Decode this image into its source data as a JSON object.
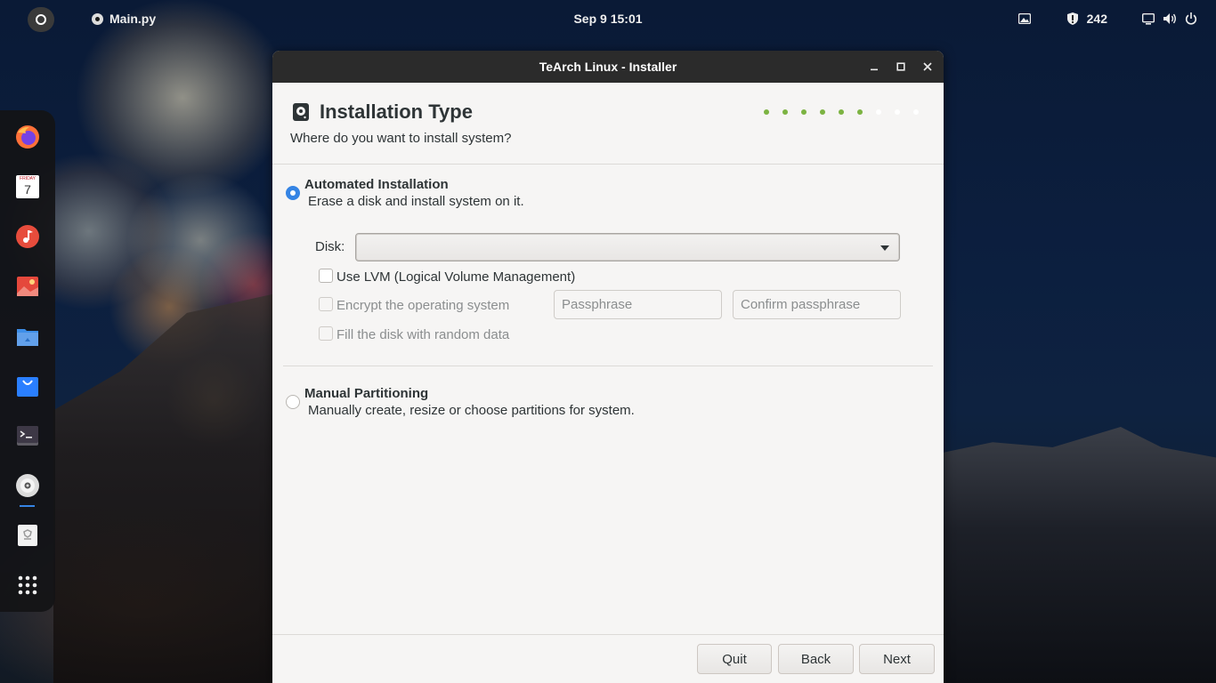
{
  "topbar": {
    "activities_icon": "activities-icon",
    "app_menu_label": "Main.py",
    "clock": "Sep 9  15:01",
    "screenshot_icon": "image-icon",
    "shield_count": "242",
    "tray_icons": [
      "screen-icon",
      "volume-icon",
      "power-icon"
    ]
  },
  "dock": {
    "items": [
      "firefox-icon",
      "calendar-icon",
      "music-icon",
      "image-viewer-icon",
      "files-icon",
      "software-store-icon",
      "terminal-icon",
      "disc-installer-icon",
      "trash-icon",
      "app-grid-icon"
    ],
    "calendar_day_name": "FRIDAY",
    "calendar_day_number": "7"
  },
  "window": {
    "title": "TeArch Linux - Installer",
    "controls": [
      "minimize-icon",
      "maximize-icon",
      "close-icon"
    ]
  },
  "header": {
    "title": "Installation Type",
    "subtitle": "Where do you want to install system?",
    "steps_done": 6,
    "steps_total": 9
  },
  "automated": {
    "title": "Automated Installation",
    "description": "Erase a disk and install system on it.",
    "selected": true,
    "disk_label": "Disk:",
    "disk_value": "",
    "lvm_label": "Use LVM (Logical Volume Management)",
    "encrypt_label": "Encrypt the operating system",
    "passphrase_placeholder": "Passphrase",
    "confirm_placeholder": "Confirm passphrase",
    "random_fill_label": "Fill the disk with random data"
  },
  "manual": {
    "title": "Manual Partitioning",
    "description": "Manually create, resize or choose partitions for system.",
    "selected": false
  },
  "footer": {
    "quit": "Quit",
    "back": "Back",
    "next": "Next"
  },
  "colors": {
    "accent": "#3584e4",
    "step_done": "#7cb342",
    "titlebar": "#2b2b2b",
    "window_bg": "#f6f5f4"
  }
}
